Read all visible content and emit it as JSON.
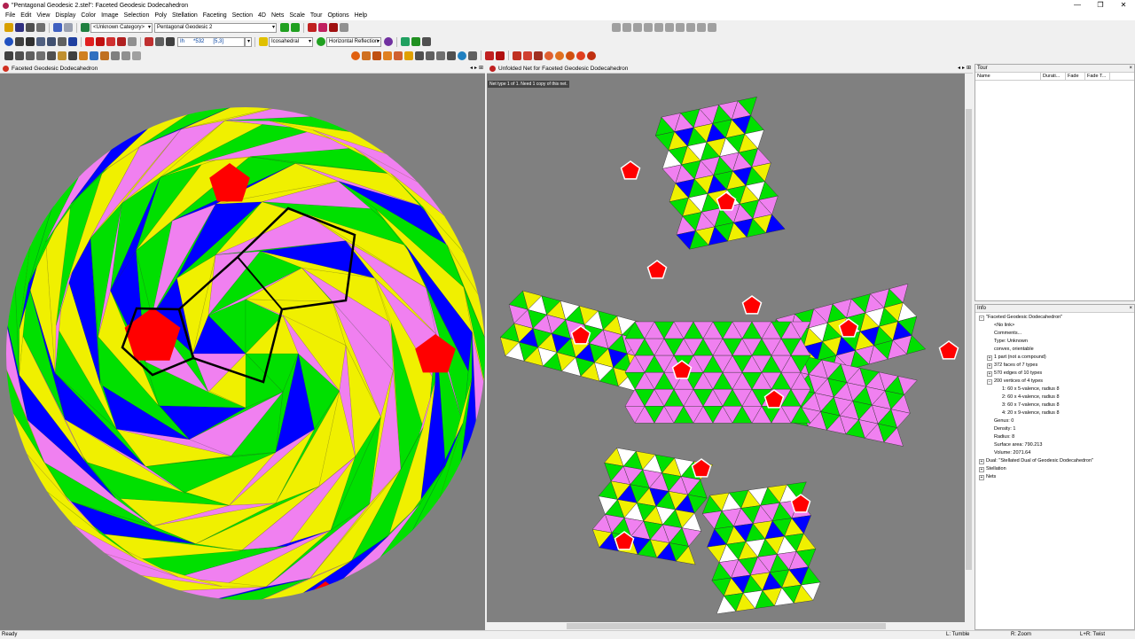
{
  "window": {
    "title": "\"Pentagonal Geodesic 2.stel\": Faceted Geodesic Dodecahedron",
    "minimize": "—",
    "maximize": "❐",
    "close": "✕"
  },
  "menu": [
    "File",
    "Edit",
    "View",
    "Display",
    "Color",
    "Image",
    "Selection",
    "Poly",
    "Stellation",
    "Faceting",
    "Section",
    "4D",
    "Nets",
    "Scale",
    "Tour",
    "Options",
    "Help"
  ],
  "toolbar": {
    "category_combo": "<Unknown Category>",
    "model_combo": "Pentagonal Geodesic 2",
    "symbol_field": "Ih",
    "count_field": "*532",
    "schlafli_field": "[5,3]",
    "symmetry_combo": "Icosahedral",
    "reflection_combo": "Horizontal Reflection"
  },
  "model_pane": {
    "title": "Faceted Geodesic Dodecahedron",
    "prev": "◂",
    "next": "▸",
    "pin": "⊞"
  },
  "net_pane": {
    "title": "Unfolded Net for Faceted Geodesic Dodecahedron",
    "notice": "Net type 1 of 1.  Need 1 copy of this net."
  },
  "tour": {
    "header": "Tour",
    "close": "×",
    "columns": [
      "Name",
      "Durati...",
      "Fade",
      "Fade T..."
    ]
  },
  "info": {
    "header": "Info",
    "close": "×",
    "tree": [
      {
        "expander": "−",
        "indent": 0,
        "text": "\"Faceted Geodesic Dodecahedron\""
      },
      {
        "expander": "",
        "indent": 1,
        "text": "<No link>"
      },
      {
        "expander": "",
        "indent": 1,
        "text": "Comments..."
      },
      {
        "expander": "",
        "indent": 1,
        "text": "Type: Unknown"
      },
      {
        "expander": "",
        "indent": 1,
        "text": "convex, orientable"
      },
      {
        "expander": "+",
        "indent": 1,
        "text": "1 part (not a compound)"
      },
      {
        "expander": "+",
        "indent": 1,
        "text": "372 faces of 7 types"
      },
      {
        "expander": "+",
        "indent": 1,
        "text": "570 edges of 10 types"
      },
      {
        "expander": "−",
        "indent": 1,
        "text": "200 vertices of 4 types"
      },
      {
        "expander": "",
        "indent": 2,
        "text": "1: 60 x 5-valence, radius 8"
      },
      {
        "expander": "",
        "indent": 2,
        "text": "2: 60 x 4-valence, radius 8"
      },
      {
        "expander": "",
        "indent": 2,
        "text": "3: 60 x 7-valence, radius 8"
      },
      {
        "expander": "",
        "indent": 2,
        "text": "4: 20 x 9-valence, radius 8"
      },
      {
        "expander": "",
        "indent": 1,
        "text": "Genus: 0"
      },
      {
        "expander": "",
        "indent": 1,
        "text": "Density: 1"
      },
      {
        "expander": "",
        "indent": 1,
        "text": "Radius: 8"
      },
      {
        "expander": "",
        "indent": 1,
        "text": "Surface area: 790.213"
      },
      {
        "expander": "",
        "indent": 1,
        "text": "Volume: 2071.64"
      },
      {
        "expander": "+",
        "indent": 0,
        "text": "Dual: \"Stellated Dual of Geodesic Dodecahedron\""
      },
      {
        "expander": "+",
        "indent": 0,
        "text": "Stellation"
      },
      {
        "expander": "+",
        "indent": 0,
        "text": "Nets"
      }
    ]
  },
  "status": {
    "left": "Ready",
    "l_action": "L: Tumble",
    "r_action": "R: Zoom",
    "lr_action": "L+R: Twist"
  },
  "colors": {
    "green": "#00e000",
    "yellow": "#f0f000",
    "blue": "#0000ff",
    "pink": "#f080f0",
    "red": "#ff0000",
    "background": "#808080"
  }
}
